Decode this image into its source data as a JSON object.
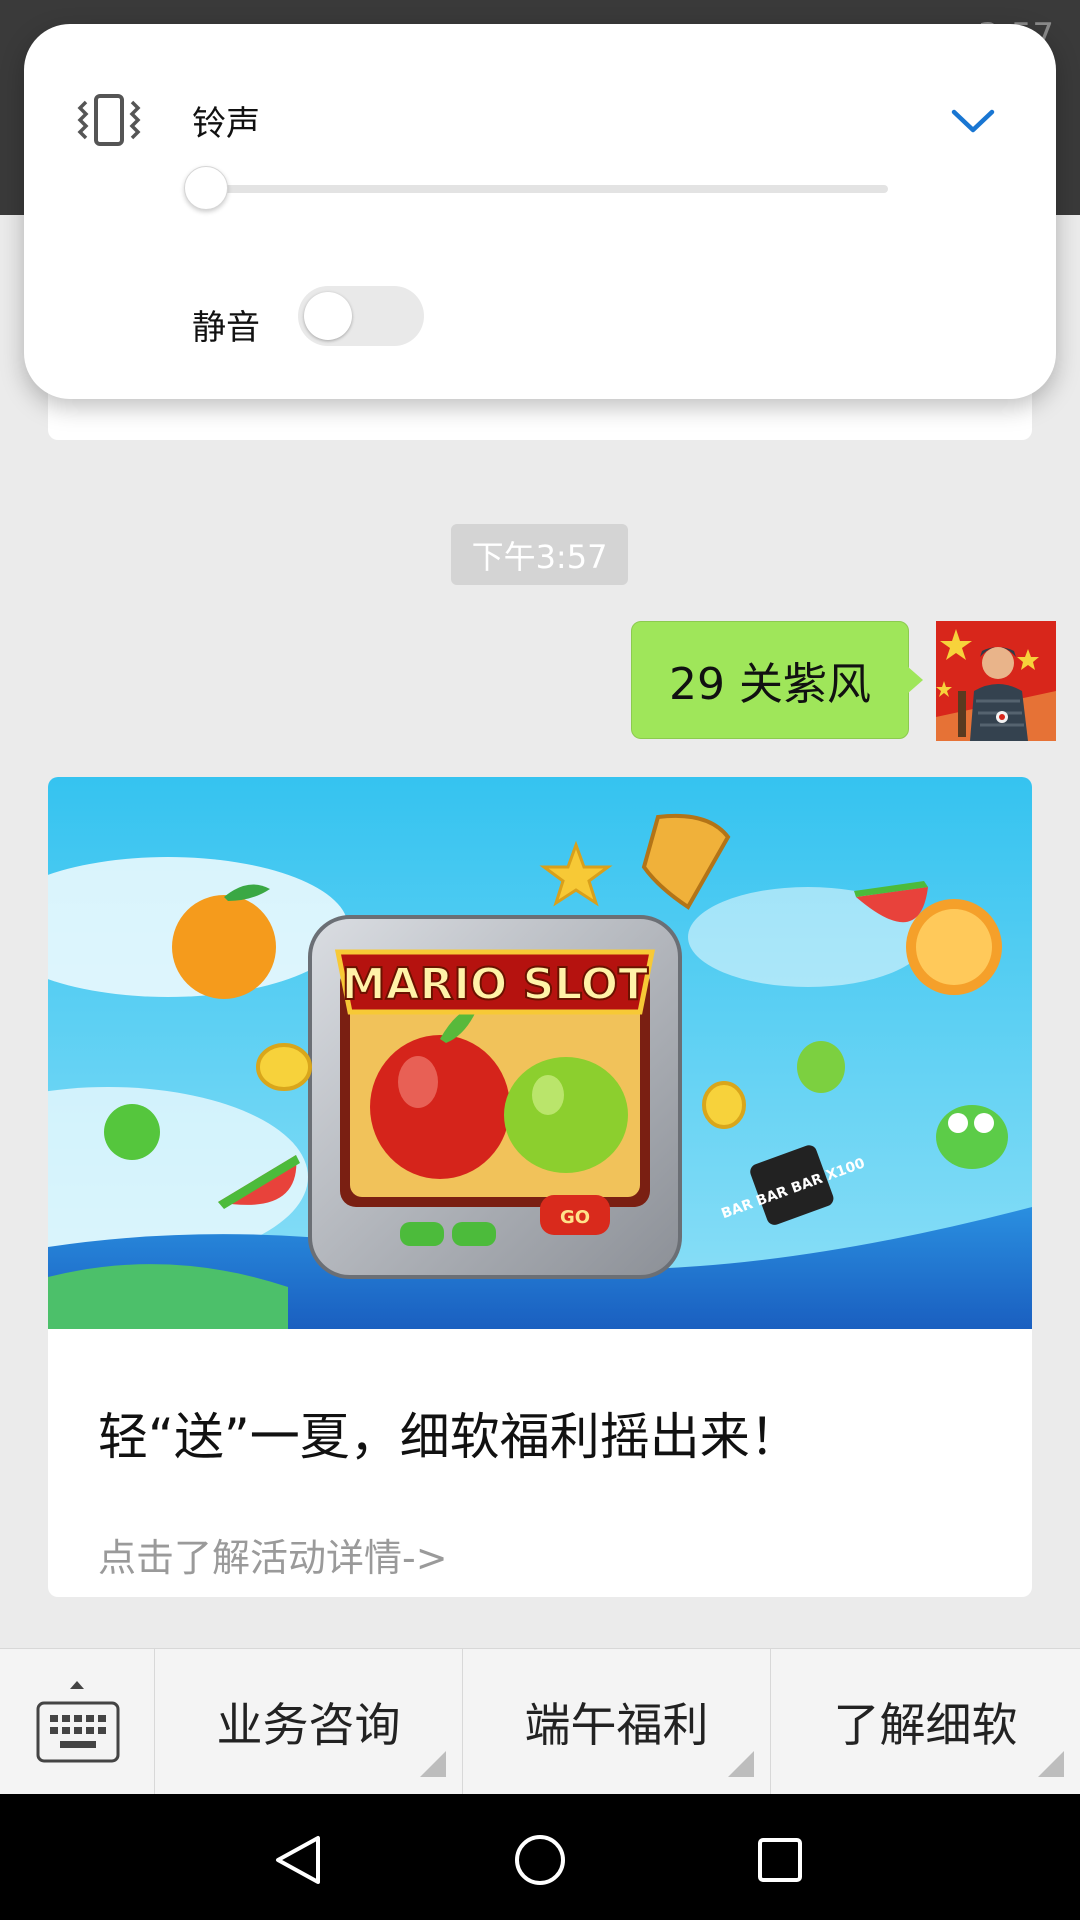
{
  "status_bar": {
    "time": "3:57"
  },
  "volume_panel": {
    "ringtone_label": "铃声",
    "ringtone_level": 0,
    "mute_label": "静音",
    "mute_on": false,
    "accent_color": "#1976d2"
  },
  "chat": {
    "timestamp": "下午3:57",
    "sent_message": "29 关紫风",
    "article": {
      "banner_text": "MARIO SLOT",
      "banner_badge": "BAR BAR BAR X100",
      "banner_go": "GO",
      "title": "轻“送”一夏，细软福利摇出来！",
      "link": "点击了解活动详情->"
    }
  },
  "bottom_menu": {
    "items": [
      {
        "label": "业务咨询"
      },
      {
        "label": "端午福利"
      },
      {
        "label": "了解细软"
      }
    ]
  },
  "colors": {
    "bubble": "#9fe65a",
    "background": "#ebebeb"
  }
}
